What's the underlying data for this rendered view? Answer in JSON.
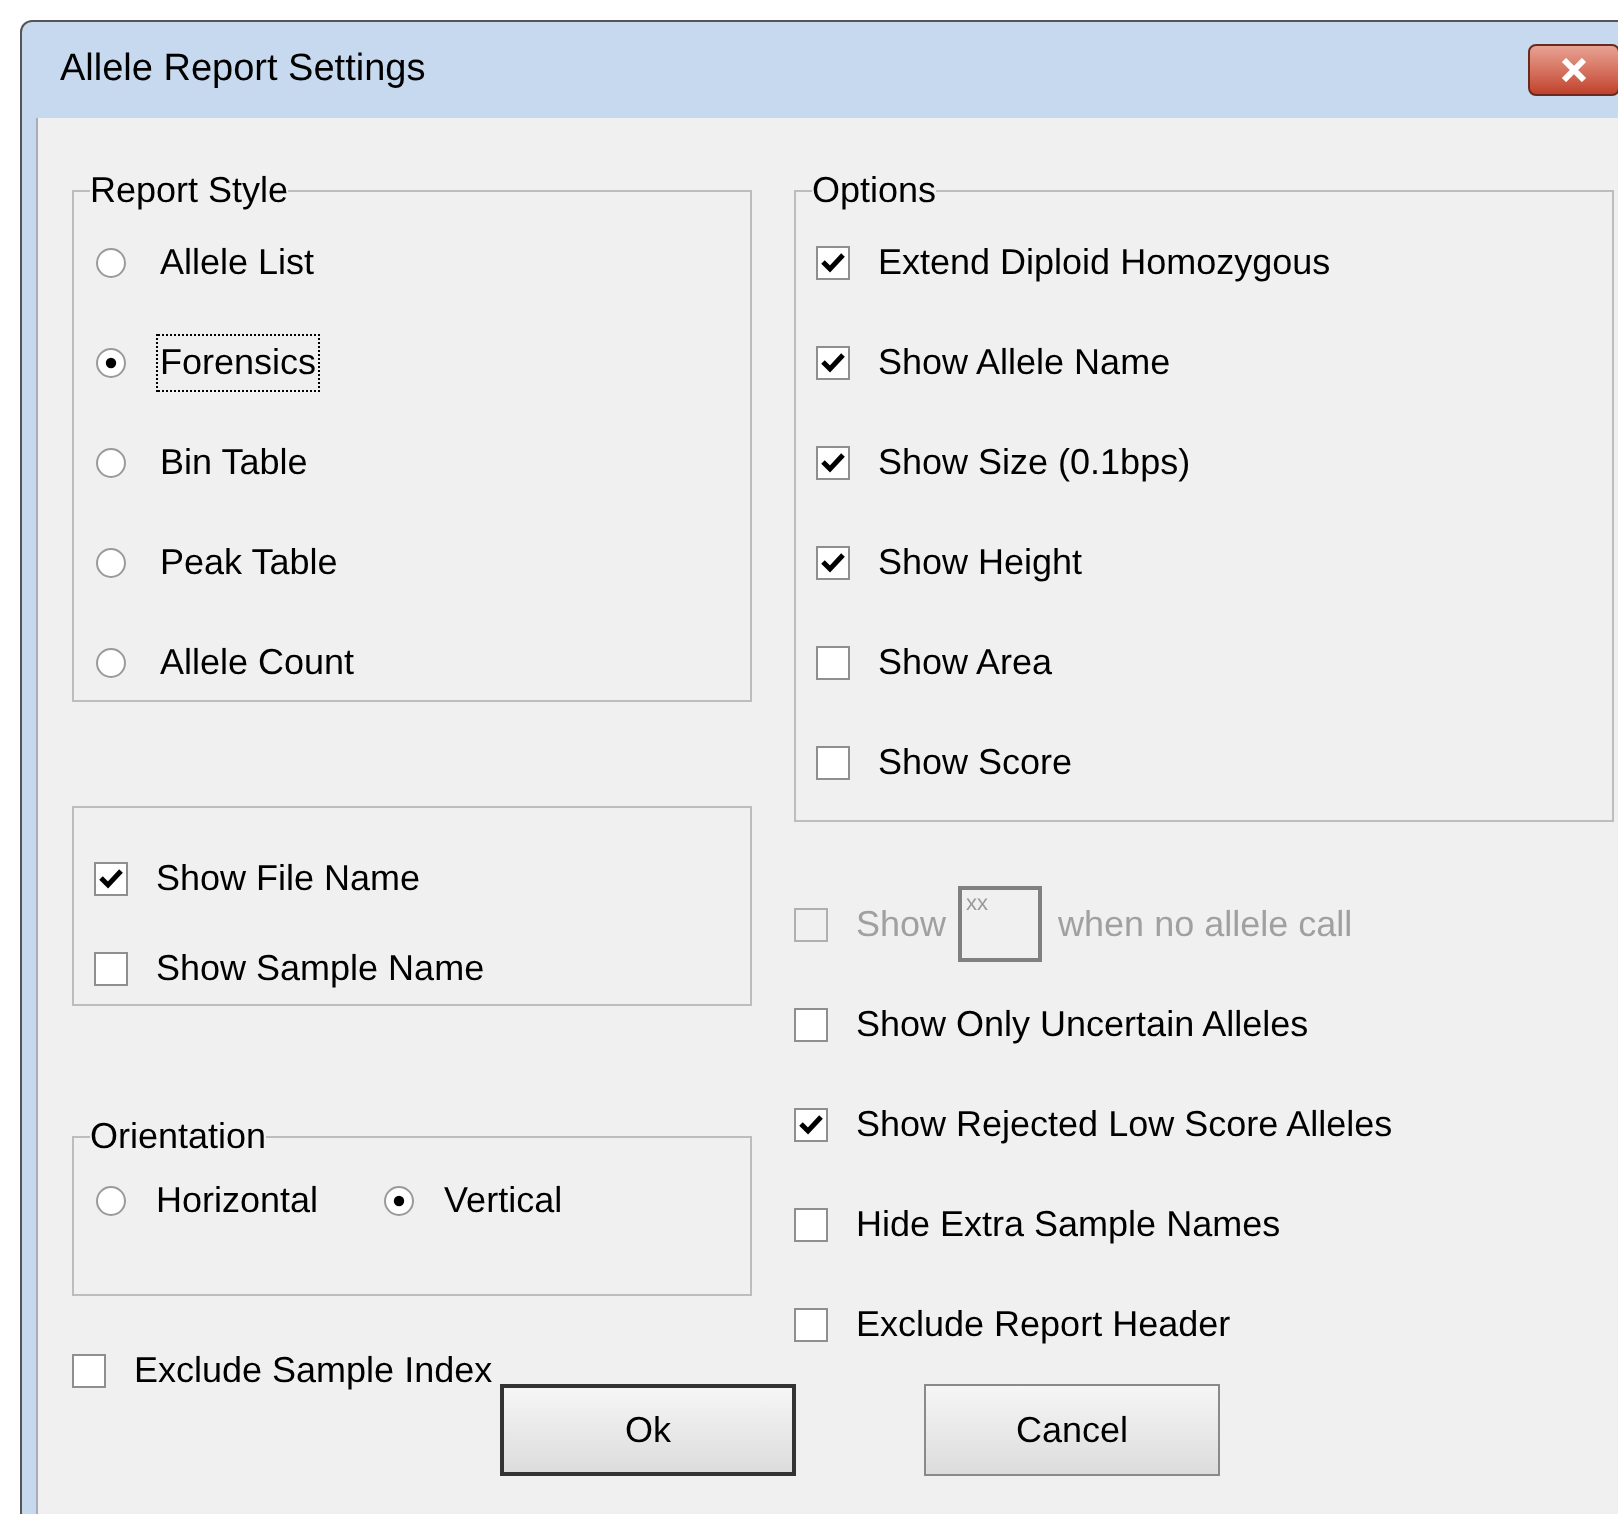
{
  "window": {
    "title": "Allele Report Settings"
  },
  "report_style": {
    "label": "Report Style",
    "items": [
      {
        "label": "Allele List",
        "selected": false,
        "focused": false
      },
      {
        "label": "Forensics",
        "selected": true,
        "focused": true
      },
      {
        "label": "Bin Table",
        "selected": false,
        "focused": false
      },
      {
        "label": "Peak Table",
        "selected": false,
        "focused": false
      },
      {
        "label": "Allele Count",
        "selected": false,
        "focused": false
      }
    ]
  },
  "options": {
    "label": "Options",
    "items": [
      {
        "label": "Extend Diploid Homozygous",
        "checked": true
      },
      {
        "label": "Show Allele Name",
        "checked": true
      },
      {
        "label": "Show Size (0.1bps)",
        "checked": true
      },
      {
        "label": "Show Height",
        "checked": true
      },
      {
        "label": "Show Area",
        "checked": false
      },
      {
        "label": "Show Score",
        "checked": false
      }
    ]
  },
  "name_options": [
    {
      "label": "Show File Name",
      "checked": true
    },
    {
      "label": "Show Sample Name",
      "checked": false
    }
  ],
  "orientation": {
    "label": "Orientation",
    "items": [
      {
        "label": "Horizontal",
        "selected": false
      },
      {
        "label": "Vertical",
        "selected": true
      }
    ]
  },
  "exclude_sample_index": {
    "label": "Exclude Sample Index",
    "checked": false
  },
  "right_options": [
    {
      "kind": "placeholder",
      "label": "Show",
      "value": "xx",
      "suffix": "when no allele call",
      "checked": false,
      "disabled": true
    },
    {
      "kind": "check",
      "label": "Show Only Uncertain Alleles",
      "checked": false,
      "disabled": false
    },
    {
      "kind": "check",
      "label": "Show Rejected Low Score Alleles",
      "checked": true,
      "disabled": false
    },
    {
      "kind": "check",
      "label": "Hide Extra Sample Names",
      "checked": false,
      "disabled": false
    },
    {
      "kind": "check",
      "label": "Exclude Report Header",
      "checked": false,
      "disabled": false
    }
  ],
  "buttons": [
    "Ok",
    "Cancel"
  ]
}
